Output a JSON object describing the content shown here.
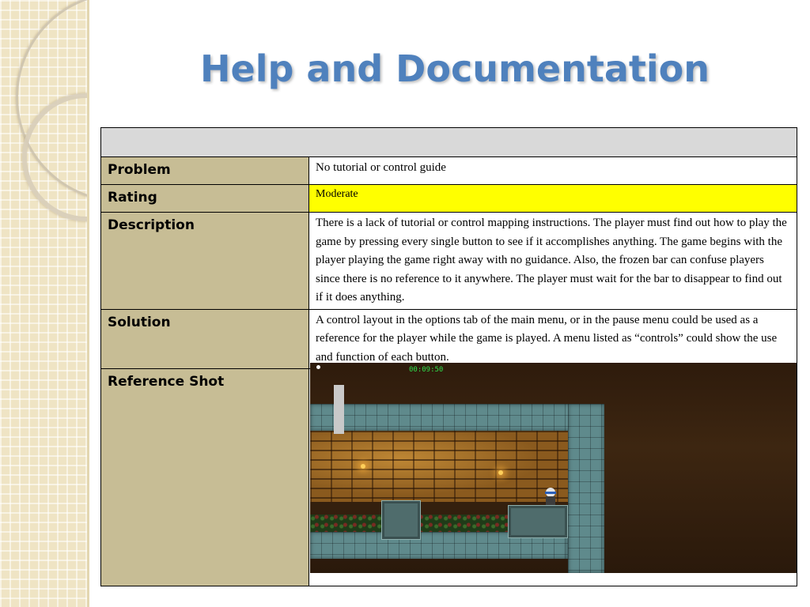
{
  "slide": {
    "title": "Help and Documentation"
  },
  "table": {
    "rows": [
      {
        "label": "Problem",
        "value": "No tutorial or control guide"
      },
      {
        "label": "Rating",
        "value": "Moderate"
      },
      {
        "label": "Description",
        "value": "There is a lack of tutorial or control mapping instructions. The player must find out how to play the game by pressing every single button to see if it accomplishes anything.  The game begins with the player playing the game right away with no guidance. Also, the frozen bar can confuse players since there is no reference to it anywhere. The player must wait for the bar to disappear to find out if it does anything."
      },
      {
        "label": "Solution",
        "value": "A control layout in the options tab of the main menu, or in the pause menu could be used as a reference for the player while the game is played. A menu listed as “controls” could show the use and function of each button."
      },
      {
        "label": "Reference Shot"
      }
    ]
  },
  "reference_shot": {
    "timer": "00:09:50"
  },
  "colors": {
    "title": "#4f81bd",
    "label_bg": "#c7bd95",
    "header_bg": "#d9d9d9",
    "rating_highlight": "#ffff00"
  }
}
